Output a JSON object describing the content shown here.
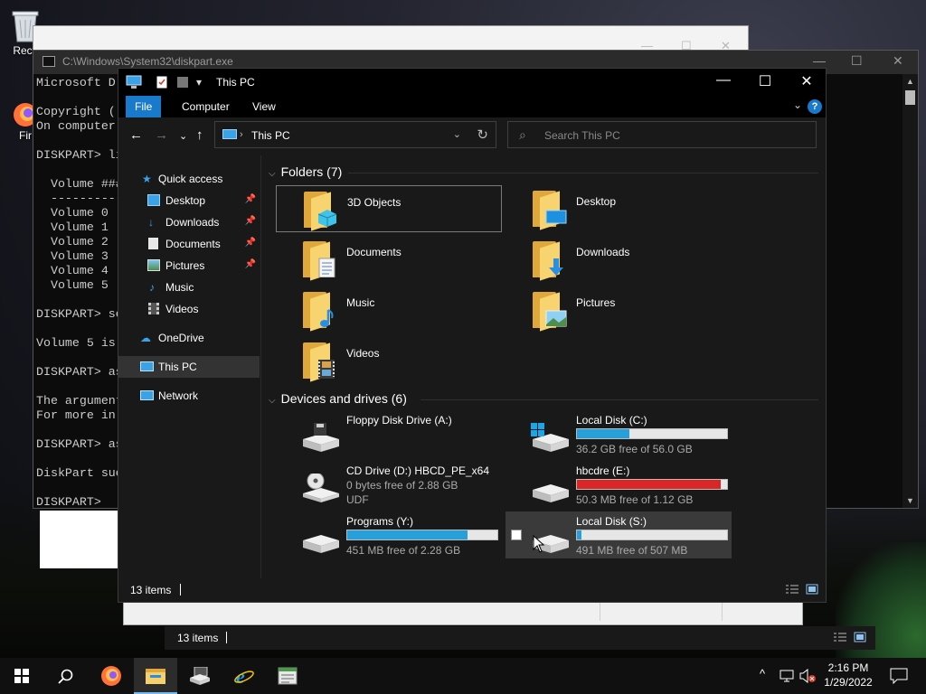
{
  "desktop": {
    "icons": [
      {
        "label": "Recy",
        "icon": "recycle-bin-icon"
      },
      {
        "label": "Fir",
        "icon": "firefox-icon"
      }
    ]
  },
  "cmd": {
    "title": "C:\\Windows\\System32\\diskpart.exe",
    "lines": [
      "Microsoft D",
      "",
      "Copyright (",
      "On computer",
      "",
      "DISKPART> li",
      "",
      "  Volume ###",
      "  ----------",
      "  Volume 0",
      "  Volume 1",
      "  Volume 2",
      "  Volume 3",
      "  Volume 4",
      "  Volume 5",
      "",
      "DISKPART> se",
      "",
      "Volume 5 is",
      "",
      "DISKPART> as",
      "",
      "The argument",
      "For more in",
      "",
      "DISKPART> as",
      "",
      "DiskPart suc",
      "",
      "DISKPART>"
    ]
  },
  "explorer": {
    "title": "This PC",
    "ribbon": {
      "file": "File",
      "computer": "Computer",
      "view": "View",
      "help": "?"
    },
    "address": "This PC",
    "search_placeholder": "Search This PC",
    "nav": {
      "quick_access": "Quick access",
      "desktop": "Desktop",
      "downloads": "Downloads",
      "documents": "Documents",
      "pictures": "Pictures",
      "music": "Music",
      "videos": "Videos",
      "onedrive": "OneDrive",
      "this_pc": "This PC",
      "network": "Network"
    },
    "folders_header": "Folders (7)",
    "folders": [
      {
        "name": "3D Objects"
      },
      {
        "name": "Desktop"
      },
      {
        "name": "Documents"
      },
      {
        "name": "Downloads"
      },
      {
        "name": "Music"
      },
      {
        "name": "Pictures"
      },
      {
        "name": "Videos"
      }
    ],
    "drives_header": "Devices and drives (6)",
    "drives": [
      {
        "name": "Floppy Disk Drive (A:)",
        "free": "",
        "usage": null
      },
      {
        "name": "Local Disk (C:)",
        "free": "36.2 GB free of 56.0 GB",
        "usage": 0.35
      },
      {
        "name": "CD Drive (D:) HBCD_PE_x64",
        "free": "0 bytes free of 2.88 GB",
        "fs": "UDF",
        "usage": null
      },
      {
        "name": "hbcdre (E:)",
        "free": "50.3 MB free of 1.12 GB",
        "usage": 0.96,
        "warning": true
      },
      {
        "name": "Programs (Y:)",
        "free": "451 MB free of 2.28 GB",
        "usage": 0.8
      },
      {
        "name": "Local Disk (S:)",
        "free": "491 MB free of 507 MB",
        "usage": 0.03
      }
    ],
    "status": "13 items",
    "accent": "#1979ca",
    "bar_color": "#26a0da",
    "bar_warning_color": "#da2626"
  },
  "back_window": {
    "status": "13 items"
  },
  "taskbar": {
    "apps": [
      "start-icon",
      "search-icon",
      "firefox-icon",
      "file-explorer-icon",
      "diskpart-icon",
      "internet-explorer-icon",
      "document-icon"
    ],
    "time": "2:16 PM",
    "date": "1/29/2022"
  }
}
